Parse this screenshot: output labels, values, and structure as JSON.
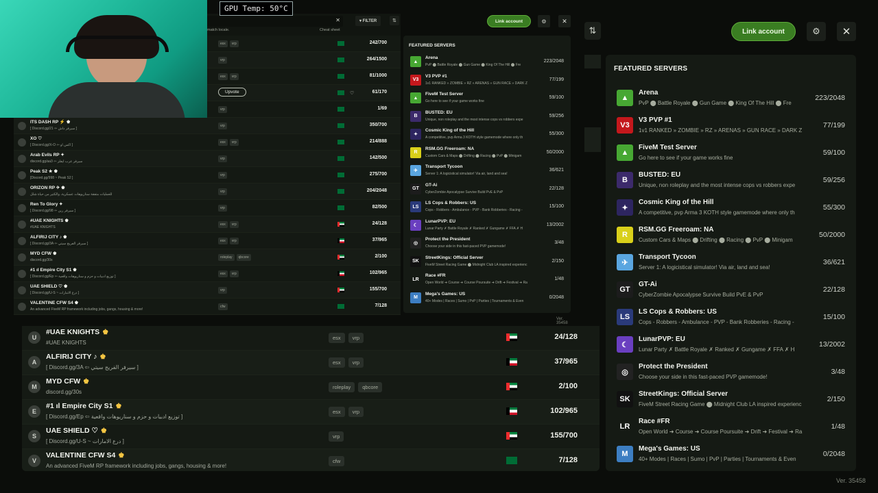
{
  "gpu_readout": "GPU Temp: 50°C",
  "header": {
    "sort_icon": "sort-arrows-icon",
    "link_account_label": "Link account",
    "gear_icon": "gear-icon",
    "close_icon": "close-icon"
  },
  "featured": {
    "title": "FEATURED SERVERS",
    "items": [
      {
        "name": "Arena",
        "desc": "PvP ⬤ Battle Royale ⬤ Gun Game ⬤ King Of The Hill ⬤ Fre",
        "count": "223/2048",
        "icon": "▲",
        "color": "#47a833"
      },
      {
        "name": "V3 PVP #1",
        "desc": "1v1 RANKED » ZOMBIE » RZ » ARENAS » GUN RACE » DARK Z",
        "count": "77/199",
        "icon": "V3",
        "color": "#c4181c"
      },
      {
        "name": "FiveM Test Server",
        "desc": "Go here to see if your game works fine",
        "count": "59/100",
        "icon": "▲",
        "color": "#47a833"
      },
      {
        "name": "BUSTED: EU",
        "desc": "Unique, non roleplay and the most intense cops vs robbers expe",
        "count": "59/256",
        "icon": "B",
        "color": "#3c2a6b"
      },
      {
        "name": "Cosmic King of the Hill",
        "desc": "A competitive, pvp Arma 3 KOTH style gamemode where only th",
        "count": "55/300",
        "icon": "✦",
        "color": "#2d2560"
      },
      {
        "name": "RSM.GG Freeroam: NA",
        "desc": "Custom Cars & Maps ⬤ Drifting ⬤ Racing ⬤ PvP ⬤ Minigam",
        "count": "50/2000",
        "icon": "R",
        "color": "#d9d01a"
      },
      {
        "name": "Transport Tycoon",
        "desc": "Server 1: A logicistical simulator! Via air, land and sea!",
        "count": "36/621",
        "icon": "✈",
        "color": "#5aa6e0"
      },
      {
        "name": "GT-Ai",
        "desc": "CyberZombie Apocalypse Survive Build PvE & PvP",
        "count": "22/128",
        "icon": "GT",
        "color": "#1c1c1c"
      },
      {
        "name": "LS Cops & Robbers: US",
        "desc": "Cops - Robbers - Ambulance - PVP - Bank Robberies - Racing -",
        "count": "15/100",
        "icon": "LS",
        "color": "#2a3a7a"
      },
      {
        "name": "LunarPVP: EU",
        "desc": "Lunar Party ✗ Battle Royale ✗ Ranked ✗ Gungame ✗ FFA ✗ H",
        "count": "13/2002",
        "icon": "☾",
        "color": "#6a3fc0"
      },
      {
        "name": "Protect the President",
        "desc": "Choose your side in this fast-paced PVP gamemode!",
        "count": "3/48",
        "icon": "◎",
        "color": "#222"
      },
      {
        "name": "StreetKings: Official Server",
        "desc": "FiveM Street Racing Game ⬤ Midnight Club LA inspired experienc",
        "count": "2/150",
        "icon": "SK",
        "color": "#111"
      },
      {
        "name": "Race #FR",
        "desc": "Open World ➜ Course ➜ Course Poursuite ➜ Drift ➜ Festival ➜ Ra",
        "count": "1/48",
        "icon": "LR",
        "color": "#151a14"
      },
      {
        "name": "Mega's Games: US",
        "desc": "40+ Modes | Races | Sumo | PvP | Parties | Tournaments & Even",
        "count": "0/2048",
        "icon": "M",
        "color": "#3d7ec2"
      }
    ]
  },
  "main_list": {
    "rows": [
      {
        "name": "#UAE KNIGHTS",
        "desc": "#UAE KNIGHTS",
        "tags": [
          "esx",
          "vrp"
        ],
        "flag": "uae",
        "players": "24/128",
        "icon": "U"
      },
      {
        "name": "ALFIRIJ CITY ♪",
        "desc": "[ Discord.gg/3A ⇦ سيرفر الفريج سيتي ]",
        "tags": [
          "esx",
          "vrp"
        ],
        "flag": "kw",
        "players": "37/965",
        "icon": "A"
      },
      {
        "name": "MYD CFW",
        "desc": "discord.gg/30s",
        "tags": [
          "roleplay",
          "qbcore"
        ],
        "flag": "uae",
        "players": "2/100",
        "icon": "M"
      },
      {
        "name": "#1 ıl Empire City S1",
        "desc": "[ Discord.gg/Ep ⇦ توزيع ادبيات و حزم و سناريوهات واقعية ]",
        "tags": [
          "esx",
          "vrp"
        ],
        "flag": "kw",
        "players": "102/965",
        "icon": "E"
      },
      {
        "name": "UAE SHIELD ♡",
        "desc": "[ Discord.gg/U-S ~ درع الامارات ]",
        "tags": [
          "vrp"
        ],
        "flag": "uae",
        "players": "155/700",
        "icon": "S"
      },
      {
        "name": "VALENTINE CFW S4",
        "desc": "An advanced FiveM RP framework including jobs, gangs, housing & more!",
        "tags": [
          "cfw"
        ],
        "flag": "sa",
        "players": "7/128",
        "icon": "V"
      }
    ]
  },
  "overlay": {
    "search_hint": "match locale.",
    "cheat_sheet": "Cheat sheet",
    "filter_label": "▾ FILTER",
    "upvote_label": "Upvote",
    "link_account_label": "Link account",
    "featured_title": "FEATURED SERVERS",
    "rows": [
      {
        "name": "",
        "desc": "",
        "tags": [
          "esx",
          "vrp"
        ],
        "flag": "sa",
        "players": "242/700"
      },
      {
        "name": "",
        "desc": "",
        "tags": [
          "vrp"
        ],
        "flag": "sa",
        "players": "264/1500"
      },
      {
        "name": "",
        "desc": "",
        "tags": [
          "esx",
          "vrp"
        ],
        "flag": "sa",
        "players": "81/1000"
      },
      {
        "name": "",
        "desc": "",
        "tags": [],
        "flag": "sa",
        "players": "61/170"
      },
      {
        "name": "",
        "desc": "",
        "tags": [
          "vrp"
        ],
        "flag": "sa",
        "players": "1/69"
      },
      {
        "name": "ITS DASH RP ⚡ ♚",
        "desc": "[ Discord.gg/21 ⇦ سيرفر داش ]",
        "tags": [
          "vrp"
        ],
        "flag": "sa",
        "players": "350/700"
      },
      {
        "name": "XO ♡",
        "desc": "[ Discord.gg/X-O ⇦ اكس او ]",
        "tags": [
          "esx",
          "vrp"
        ],
        "flag": "sa",
        "players": "214/888"
      },
      {
        "name": "Arab Evils RP ✦",
        "desc": "discord.gg/aa3 ⇦ سيرفر عرب ايفلز",
        "tags": [
          "vrp"
        ],
        "flag": "sa",
        "players": "142/500"
      },
      {
        "name": "Peak S2 ★ ♚",
        "desc": "[Discord.gg/998 ~ Peak S2 ]",
        "tags": [
          "vrp"
        ],
        "flag": "sa",
        "players": "275/700"
      },
      {
        "name": "ORIZON RP ✈ ♚",
        "desc": "للعمليات متفقة سناريوهات عسكرية، والكثير من حياة شلل",
        "tags": [
          "vrp"
        ],
        "flag": "sa",
        "players": "204/2048"
      },
      {
        "name": "Ren To Glory ✦",
        "desc": "[ Discord.gg/98 ⇦ سيرفر رين ]",
        "tags": [
          "vrp"
        ],
        "flag": "sa",
        "players": "82/500"
      },
      {
        "name": "#UAE KNIGHTS ♚",
        "desc": "#UAE KNIGHTS",
        "tags": [
          "esx",
          "vrp"
        ],
        "flag": "uae",
        "players": "24/128"
      },
      {
        "name": "ALFIRIJ CITY ♪ ♚",
        "desc": "[ Discord.gg/3A ⇦ سيرفر الفريج سيتي ]",
        "tags": [
          "esx",
          "vrp"
        ],
        "flag": "kw",
        "players": "37/965"
      },
      {
        "name": "MYD CFW ♚",
        "desc": "discord.gg/30s",
        "tags": [
          "roleplay",
          "qbcore"
        ],
        "flag": "uae",
        "players": "2/100"
      },
      {
        "name": "#1 ıl Empire City S1 ♚",
        "desc": "[ Discord.gg/Ep ⇦ توزيع ادبيات و حزم و سناريوهات واقعية ]",
        "tags": [
          "esx",
          "vrp"
        ],
        "flag": "kw",
        "players": "102/965"
      },
      {
        "name": "UAE SHIELD ♡ ♚",
        "desc": "[ Discord.gg/U-S ~ درع الامارات ]",
        "tags": [
          "vrp"
        ],
        "flag": "uae",
        "players": "155/700"
      },
      {
        "name": "VALENTINE CFW S4 ♚",
        "desc": "An advanced FiveM RP framework including jobs, gangs, housing & more!",
        "tags": [
          "cfw"
        ],
        "flag": "sa",
        "players": "7/128"
      }
    ]
  },
  "version": "Ver. 35458"
}
